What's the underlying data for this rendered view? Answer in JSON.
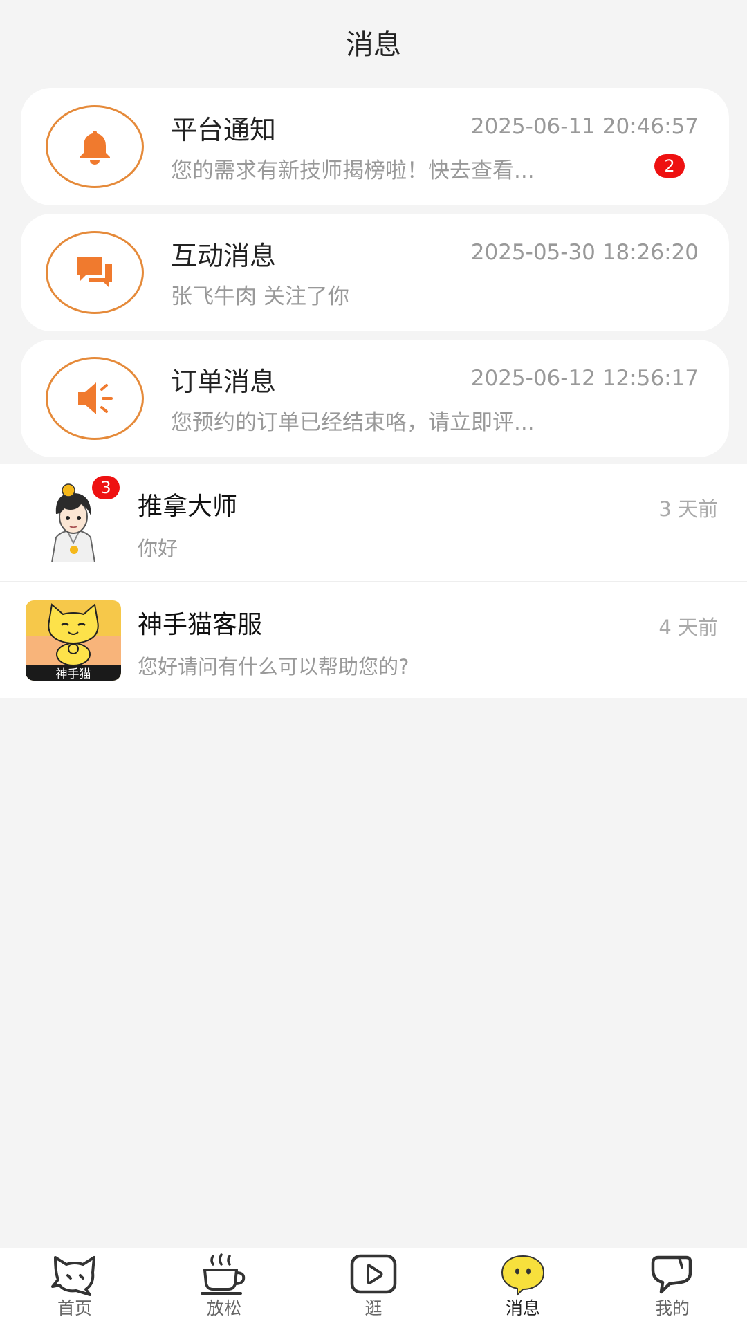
{
  "header": {
    "title": "消息"
  },
  "system_cards": [
    {
      "icon": "bell-icon",
      "title": "平台通知",
      "time": "2025-06-11 20:46:57",
      "subtitle": "您的需求有新技师揭榜啦！快去查看...",
      "badge": "2"
    },
    {
      "icon": "chat-bubbles-icon",
      "title": "互动消息",
      "time": "2025-05-30 18:26:20",
      "subtitle": "张飞牛肉 关注了你"
    },
    {
      "icon": "speaker-icon",
      "title": "订单消息",
      "time": "2025-06-12 12:56:17",
      "subtitle": "您预约的订单已经结束咯，请立即评..."
    }
  ],
  "chats": [
    {
      "name": "推拿大师",
      "time": "3 天前",
      "message": "你好",
      "badge": "3",
      "avatar": "anime-boy-avatar"
    },
    {
      "name": "神手猫客服",
      "time": "4 天前",
      "message": "您好请问有什么可以帮助您的?",
      "avatar": "cat-logo-avatar",
      "avatar_text": "神手猫"
    }
  ],
  "tabbar": {
    "items": [
      {
        "label": "首页",
        "icon": "cat-head-icon"
      },
      {
        "label": "放松",
        "icon": "coffee-cup-icon"
      },
      {
        "label": "逛",
        "icon": "play-icon"
      },
      {
        "label": "消息",
        "icon": "message-icon",
        "active": true
      },
      {
        "label": "我的",
        "icon": "profile-bubble-icon"
      }
    ]
  },
  "colors": {
    "accent_orange": "#f07a2e",
    "icon_ring": "#e58a3a",
    "badge_red": "#ee1111",
    "tab_active_yellow": "#f7e03c"
  }
}
